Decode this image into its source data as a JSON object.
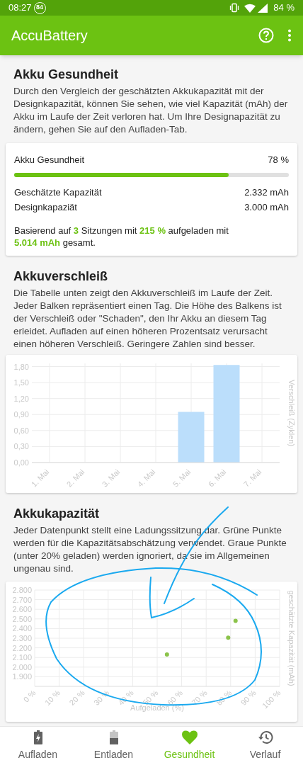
{
  "status_bar": {
    "time": "08:27",
    "notification_badge": "84",
    "battery": "84 %"
  },
  "app_bar": {
    "title": "AccuBattery"
  },
  "health": {
    "title": "Akku Gesundheit",
    "description": "Durch den Vergleich der geschätzten Akkukapazität mit der Designkapazität, können Sie sehen, wie viel Kapazität (mAh) der Akku im Laufe der Zeit verloren hat. Um Ihre Designapazität zu ändern, gehen Sie auf den Aufladen-Tab.",
    "card": {
      "label": "Akku Gesundheit",
      "value": "78 %",
      "level": 0.78,
      "rows": [
        {
          "label": "Geschätzte Kapazität",
          "value": "2.332 mAh"
        },
        {
          "label": "Designkapaziät",
          "value": "3.000 mAh"
        }
      ],
      "summary": "Basierend auf **3** Sitzungen mit **215 %** aufgeladen mit **5.014 mAh** gesamt."
    }
  },
  "wear": {
    "title": "Akkuverschleiß",
    "description": "Die Tabelle unten zeigt den Akkuverschleiß im Laufe der Zeit. Jeder Balken repräsentiert einen Tag. Die Höhe des Balkens ist der Verschleiß oder \"Schaden\", den Ihr Akku an diesem Tag erleidet. Aufladen auf einen höheren Prozentsatz verursacht einen höheren Verschleiß. Geringere Zahlen sind besser.",
    "chart_data": {
      "type": "bar",
      "ylabel": "Verschleiß (Zyklen)",
      "categories": [
        "1. Mai",
        "2. Mai",
        "3. Mai",
        "4. Mai",
        "5. Mai",
        "6. Mai",
        "7. Mai"
      ],
      "series": [
        {
          "color": "#bbdefb",
          "values": [
            0,
            0,
            0,
            0,
            0.95,
            1.83,
            0
          ]
        }
      ],
      "ylim": [
        0,
        1.86
      ],
      "grid": true,
      "yticks": [
        {
          "value": 0,
          "label": "0,00"
        },
        {
          "value": 0.3,
          "label": "0,30"
        },
        {
          "value": 0.6,
          "label": "0,60"
        },
        {
          "value": 0.9,
          "label": "0,90"
        },
        {
          "value": 1.2,
          "label": "1,20"
        },
        {
          "value": 1.5,
          "label": "1,50"
        },
        {
          "value": 1.8,
          "label": "1,80"
        }
      ]
    }
  },
  "capacity": {
    "title": "Akkukapazität",
    "description": "Jeder Datenpunkt stellt eine Ladungssitzung dar. Grüne Punkte werden für die Kapazitätsabschätzung verwendet. Graue Punkte (unter 20% geladen) werden ignoriert, da sie im Allgemeinen ungenau sind.",
    "chart_data": {
      "type": "scatter",
      "xlabel": "Aufgeladen (%)",
      "ylabel": "geschätzte Kapazität (mAh)",
      "x": [
        54,
        79,
        82
      ],
      "series": [
        {
          "color": "#8bc34a",
          "values": [
            2130,
            2305,
            2480
          ]
        }
      ],
      "xlim": [
        0,
        100
      ],
      "ylim": [
        1800,
        2800
      ],
      "grid": true,
      "xticks": [
        {
          "value": 0,
          "label": "0 %"
        },
        {
          "value": 10,
          "label": "10 %"
        },
        {
          "value": 20,
          "label": "20 %"
        },
        {
          "value": 30,
          "label": "30 %"
        },
        {
          "value": 40,
          "label": "40 %"
        },
        {
          "value": 50,
          "label": "50 %"
        },
        {
          "value": 60,
          "label": "60 %"
        },
        {
          "value": 70,
          "label": "70 %"
        },
        {
          "value": 80,
          "label": "80 %"
        },
        {
          "value": 90,
          "label": "90 %"
        },
        {
          "value": 100,
          "label": "100 %"
        }
      ],
      "yticks": [
        {
          "value": 1900,
          "label": "1.900"
        },
        {
          "value": 2000,
          "label": "2.000"
        },
        {
          "value": 2100,
          "label": "2.100"
        },
        {
          "value": 2200,
          "label": "2.200"
        },
        {
          "value": 2300,
          "label": "2.300"
        },
        {
          "value": 2400,
          "label": "2.400"
        },
        {
          "value": 2500,
          "label": "2.500"
        },
        {
          "value": 2600,
          "label": "2.600"
        },
        {
          "value": 2700,
          "label": "2.700"
        },
        {
          "value": 2800,
          "label": "2.800"
        }
      ]
    }
  },
  "bottom_nav": [
    {
      "kind": "charging",
      "label": "Aufladen",
      "selected": false
    },
    {
      "kind": "discharging",
      "label": "Entladen",
      "selected": false
    },
    {
      "kind": "health",
      "label": "Gesundheit",
      "selected": true
    },
    {
      "kind": "history",
      "label": "Verlauf",
      "selected": false
    }
  ]
}
